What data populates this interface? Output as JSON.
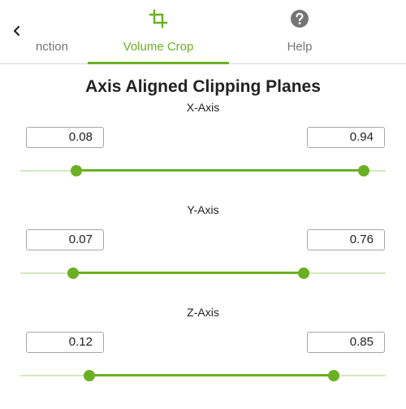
{
  "tabs": {
    "back_icon": "chevron-left-icon",
    "function": {
      "label": "nction"
    },
    "volume_crop": {
      "label": "Volume Crop",
      "icon": "crop-icon",
      "active": true
    },
    "help": {
      "label": "Help",
      "icon": "help-circle-icon"
    }
  },
  "colors": {
    "accent": "#6ab023",
    "track": "#d4e8be",
    "inactive_text": "#757575"
  },
  "panel": {
    "title": "Axis Aligned Clipping Planes",
    "axes": [
      {
        "label": "X-Axis",
        "min": "0.08",
        "max": "0.94"
      },
      {
        "label": "Y-Axis",
        "min": "0.07",
        "max": "0.76"
      },
      {
        "label": "Z-Axis",
        "min": "0.12",
        "max": "0.85"
      }
    ]
  }
}
